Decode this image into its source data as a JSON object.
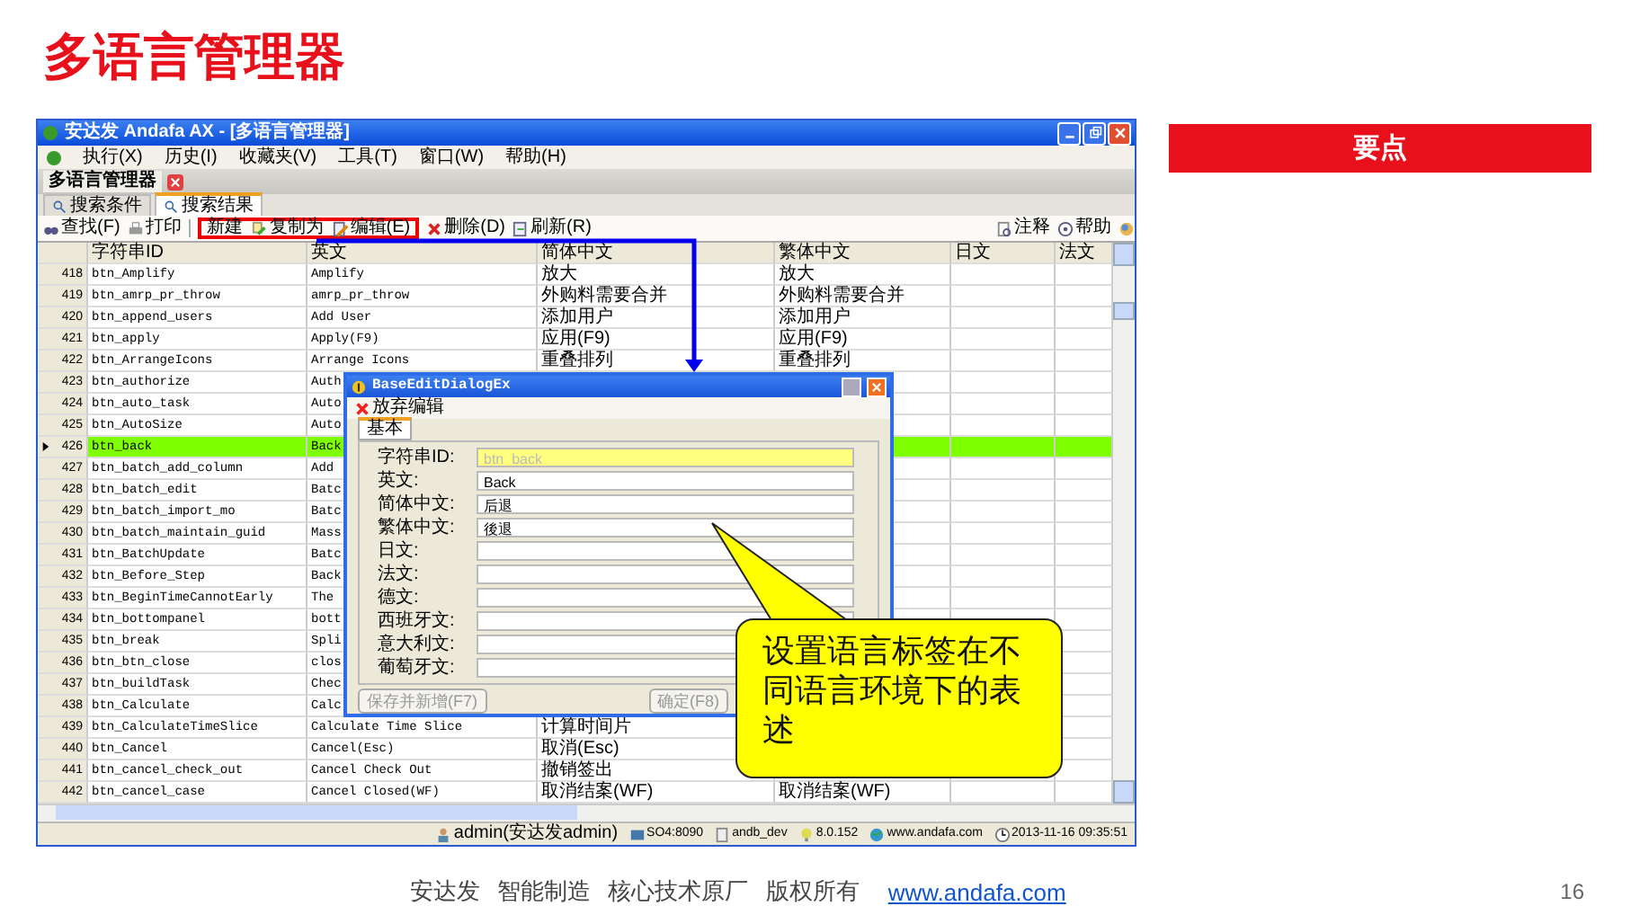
{
  "slide_title": "多语言管理器",
  "window": {
    "title": "安达发 Andafa AX - [多语言管理器]"
  },
  "menu": [
    "执行(X)",
    "历史(I)",
    "收藏夹(V)",
    "工具(T)",
    "窗口(W)",
    "帮助(H)"
  ],
  "document_tab": {
    "label": "多语言管理器"
  },
  "tabs": [
    {
      "label": "搜索条件",
      "selected": false
    },
    {
      "label": "搜索结果",
      "selected": true
    }
  ],
  "toolbar": {
    "left": [
      {
        "label": "查找(F)",
        "kind": "find"
      },
      {
        "label": "打印",
        "kind": "print"
      }
    ],
    "highlighted": [
      {
        "label": "新建",
        "kind": "plain"
      },
      {
        "label": "复制为",
        "kind": "copy"
      },
      {
        "label": "编辑(E)",
        "kind": "edit"
      }
    ],
    "more": [
      {
        "label": "删除(D)",
        "kind": "delete"
      },
      {
        "label": "刷新(R)",
        "kind": "refresh"
      }
    ],
    "right": [
      {
        "label": "注释",
        "kind": "note"
      },
      {
        "label": "帮助",
        "kind": "help"
      }
    ]
  },
  "table": {
    "columns": [
      "字符串ID",
      "英文",
      "简体中文",
      "繁体中文",
      "日文",
      "法文"
    ],
    "rows": [
      {
        "num": "418",
        "id": "btn_Amplify",
        "en": "Amplify",
        "cn": "放大",
        "tw": "放大",
        "selected": false
      },
      {
        "num": "419",
        "id": "btn_amrp_pr_throw",
        "en": "amrp_pr_throw",
        "cn": "外购料需要合并",
        "tw": "外购料需要合并",
        "selected": false
      },
      {
        "num": "420",
        "id": "btn_append_users",
        "en": "Add User",
        "cn": "添加用户",
        "tw": "添加用户",
        "selected": false
      },
      {
        "num": "421",
        "id": "btn_apply",
        "en": "Apply(F9)",
        "cn": "应用(F9)",
        "tw": "应用(F9)",
        "selected": false
      },
      {
        "num": "422",
        "id": "btn_ArrangeIcons",
        "en": "Arrange Icons",
        "cn": "重叠排列",
        "tw": "重叠排列",
        "selected": false
      },
      {
        "num": "423",
        "id": "btn_authorize",
        "en": "Auth",
        "selected": false
      },
      {
        "num": "424",
        "id": "btn_auto_task",
        "en": "Auto",
        "selected": false
      },
      {
        "num": "425",
        "id": "btn_AutoSize",
        "en": "Auto",
        "selected": false
      },
      {
        "num": "426",
        "id": "btn_back",
        "en": "Back",
        "selected": true
      },
      {
        "num": "427",
        "id": "btn_batch_add_column",
        "en": "Add",
        "selected": false
      },
      {
        "num": "428",
        "id": "btn_batch_edit",
        "en": "Batc",
        "selected": false
      },
      {
        "num": "429",
        "id": "btn_batch_import_mo",
        "en": "Batc",
        "selected": false
      },
      {
        "num": "430",
        "id": "btn_batch_maintain_guid",
        "en": "Mass",
        "selected": false
      },
      {
        "num": "431",
        "id": "btn_BatchUpdate",
        "en": "Batc",
        "selected": false
      },
      {
        "num": "432",
        "id": "btn_Before_Step",
        "en": "Back",
        "selected": false
      },
      {
        "num": "433",
        "id": "btn_BeginTimeCannotEarly",
        "en": "The",
        "selected": false
      },
      {
        "num": "434",
        "id": "btn_bottompanel",
        "en": "bott",
        "selected": false
      },
      {
        "num": "435",
        "id": "btn_break",
        "en": "Spli",
        "selected": false
      },
      {
        "num": "436",
        "id": "btn_btn_close",
        "en": "clos",
        "selected": false
      },
      {
        "num": "437",
        "id": "btn_buildTask",
        "en": "Chec",
        "selected": false
      },
      {
        "num": "438",
        "id": "btn_Calculate",
        "en": "Calc",
        "selected": false
      },
      {
        "num": "439",
        "id": "btn_CalculateTimeSlice",
        "en": "Calculate Time Slice",
        "cn": "计算时间片",
        "selected": false
      },
      {
        "num": "440",
        "id": "btn_Cancel",
        "en": "Cancel(Esc)",
        "cn": "取消(Esc)",
        "selected": false
      },
      {
        "num": "441",
        "id": "btn_cancel_check_out",
        "en": "Cancel Check Out",
        "cn": "撤销签出",
        "selected": false
      },
      {
        "num": "442",
        "id": "btn_cancel_case",
        "en": "Cancel Closed(WF)",
        "cn": "取消结案(WF)",
        "tw": "取消结案(WF)",
        "selected": false
      }
    ]
  },
  "dialog": {
    "title": "BaseEditDialogEx",
    "toolbar_button": "放弃编辑",
    "tab": "基本",
    "fields": [
      {
        "label": "字符串ID:",
        "value": "btn_back",
        "readonly": true
      },
      {
        "label": "英文:",
        "value": "Back",
        "readonly": false
      },
      {
        "label": "简体中文:",
        "value": "后退",
        "readonly": false
      },
      {
        "label": "繁体中文:",
        "value": "後退",
        "readonly": false
      },
      {
        "label": "日文:",
        "readonly": false
      },
      {
        "label": "法文:",
        "readonly": false
      },
      {
        "label": "德文:",
        "readonly": false
      },
      {
        "label": "西班牙文:",
        "readonly": false
      },
      {
        "label": "意大利文:",
        "readonly": false
      },
      {
        "label": "葡萄牙文:",
        "readonly": false
      }
    ],
    "buttons": [
      {
        "label": "保存并新增(F7)",
        "disabled": true
      },
      {
        "label": "确定(F8)",
        "disabled": true
      }
    ]
  },
  "callout": "设置语言标签在不同语言环境下的表述",
  "status_bar": [
    {
      "text": "admin(安达发admin)",
      "kind": "user"
    },
    {
      "text": "SO4:8090",
      "kind": "server"
    },
    {
      "text": "andb_dev",
      "kind": "database"
    },
    {
      "text": "8.0.152",
      "kind": "bulb"
    },
    {
      "text": "www.andafa.com",
      "kind": "globe"
    },
    {
      "text": "2013-11-16 09:35:51",
      "kind": "clock"
    }
  ],
  "side_panel": {
    "heading": "要点"
  },
  "footer": {
    "text": "安达发 智能制造 核心技术原厂 版权所有",
    "link": "www.andafa.com",
    "page": "16"
  }
}
